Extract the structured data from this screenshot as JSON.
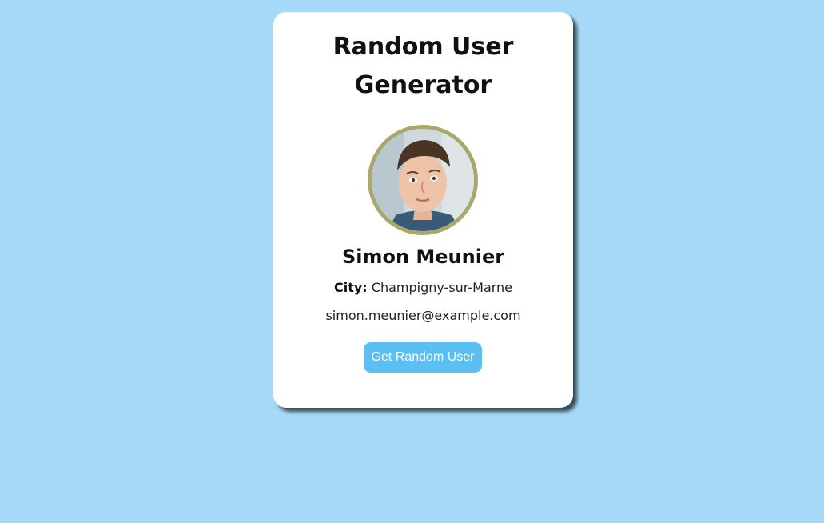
{
  "card": {
    "title": "Random User Generator",
    "user": {
      "name": "Simon Meunier",
      "city_label": "City:",
      "city": "Champigny-sur-Marne",
      "email": "simon.meunier@example.com"
    },
    "button_label": "Get Random User"
  },
  "colors": {
    "background": "#a5d9f7",
    "button": "#5bbff4",
    "avatar_border": "#aaa76b"
  }
}
